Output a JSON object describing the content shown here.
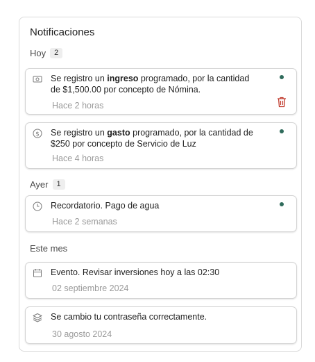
{
  "panel": {
    "title": "Notificaciones"
  },
  "sections": [
    {
      "label": "Hoy",
      "count": "2"
    },
    {
      "label": "Ayer",
      "count": "1"
    },
    {
      "label": "Este mes"
    }
  ],
  "notifications": [
    {
      "icon": "money-icon",
      "pre": "Se registro un ",
      "bold": "ingreso",
      "post": " programado, por la cantidad de $1,500.00 por concepto de Nómina.",
      "time": "Hace 2 horas",
      "unread": true,
      "has_delete": true
    },
    {
      "icon": "dollar-circle-icon",
      "pre": "Se registro un ",
      "bold": "gasto",
      "post": " programado, por la cantidad de $250 por concepto de Servicio de Luz",
      "time": "Hace 4 horas",
      "unread": true
    },
    {
      "icon": "clock-icon",
      "pre": "Recordatorio. Pago de agua",
      "time": "Hace 2 semanas",
      "unread": true
    },
    {
      "icon": "calendar-icon",
      "pre": "Evento. Revisar inversiones hoy a las 02:30",
      "time": "02 septiembre 2024",
      "unread": false
    },
    {
      "icon": "layers-icon",
      "pre": "Se cambio tu contraseña correctamente.",
      "time": "30 agosto 2024",
      "unread": false
    }
  ],
  "colors": {
    "unread_dot": "#2f6b5b",
    "delete_icon": "#c0392b"
  }
}
